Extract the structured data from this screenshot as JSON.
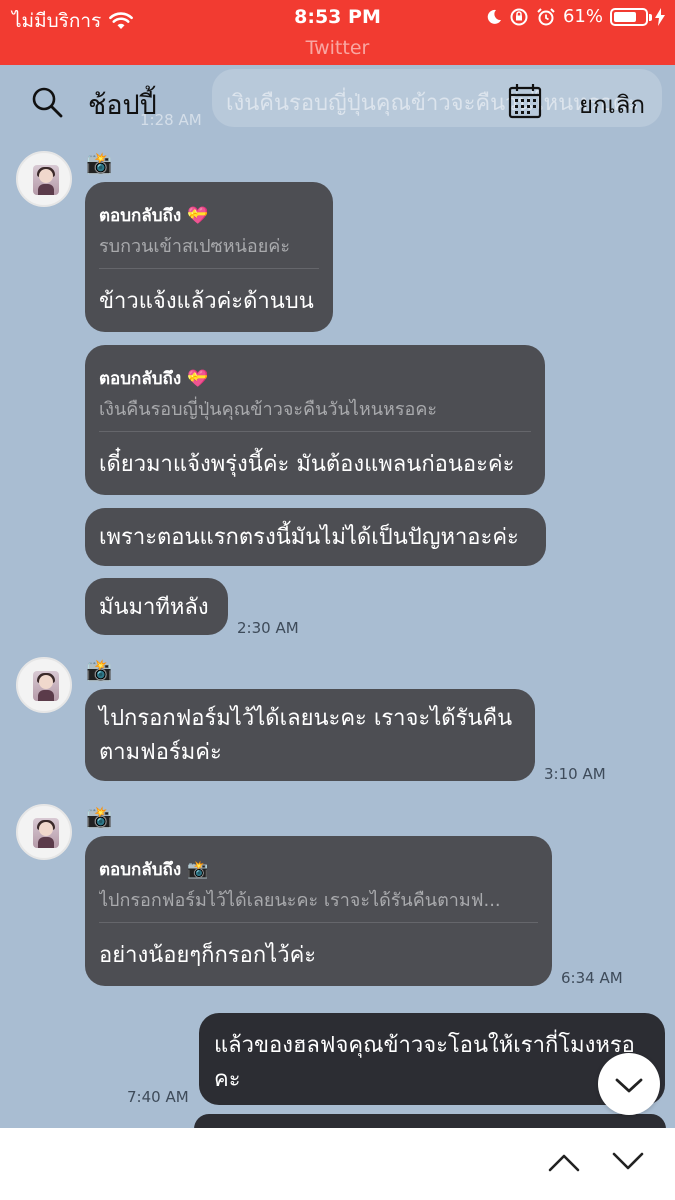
{
  "status_bar": {
    "carrier": "ไม่มีบริการ",
    "time": "8:53 PM",
    "battery": "61%",
    "back_app": "Twitter"
  },
  "search": {
    "query": "ช้อปปี้",
    "cancel_label": "ยกเลิก",
    "ghost_text": "เงินคืนรอบญี่ปุ่นคุณข้าวจะคืนวันไหนหรอคะ",
    "ghost_time": "1:28 AM"
  },
  "messages": [
    {
      "sender_emoji": "📸",
      "reply_label": "ตอบกลับถึง 💝",
      "reply_preview": "รบกวนเข้าสเปซหน่อยค่ะ",
      "text": "ข้าวแจ้งแล้วค่ะด้านบน"
    },
    {
      "reply_label": "ตอบกลับถึง 💝",
      "reply_preview": "เงินคืนรอบญี่ปุ่นคุณข้าวจะคืนวันไหนหรอคะ",
      "text": "เดี๋ยวมาแจ้งพรุ่งนี้ค่ะ มันต้องแพลนก่อนอะค่ะ"
    },
    {
      "text": "เพราะตอนแรกตรงนี้มันไม่ได้เป็นปัญหาอะค่ะ"
    },
    {
      "text": "มันมาทีหลัง",
      "time": "2:30 AM"
    },
    {
      "sender_emoji": "📸",
      "text_line1": "ไปกรอกฟอร์มไว้ได้เลยนะคะ เราจะได้รันคืน",
      "text_line2": "ตามฟอร์มค่ะ",
      "time": "3:10 AM"
    },
    {
      "sender_emoji": "📸",
      "reply_label": "ตอบกลับถึง 📸",
      "reply_preview": "ไปกรอกฟอร์มไว้ได้เลยนะคะ เราจะได้รันคืนตามฟ...",
      "text": "อย่างน้อยๆก็กรอกไว้ค่ะ",
      "time": "6:34 AM"
    },
    {
      "direction": "outgoing",
      "text_line1": "แล้วของฮลฟจคุณข้าวจะโอนให้เรากี่โมงหรอ",
      "text_line2": "คะ",
      "time": "7:40 AM"
    }
  ]
}
